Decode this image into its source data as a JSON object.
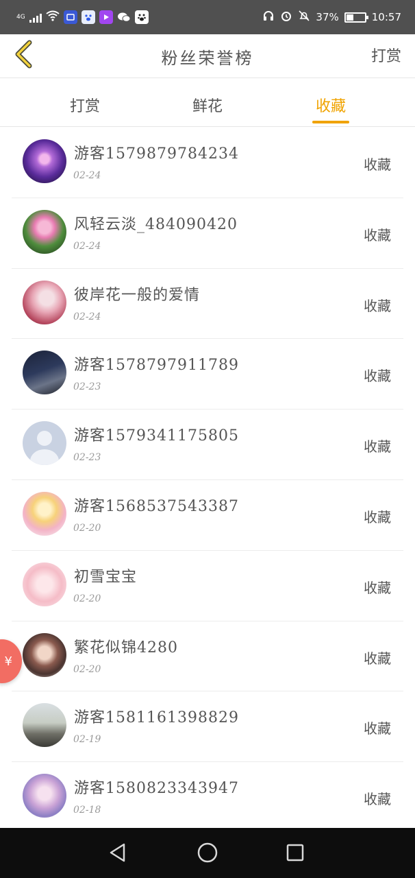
{
  "status_bar": {
    "network": "4G",
    "battery": "37%",
    "time": "10:57",
    "app_icons": [
      "app-badge-icon",
      "baidu-icon",
      "video-icon",
      "wechat-icon",
      "paw-icon"
    ]
  },
  "nav": {
    "title": "粉丝荣誉榜",
    "action": "打赏",
    "back_icon": "chevron-left-icon"
  },
  "tabs": [
    {
      "label": "打赏",
      "active": false
    },
    {
      "label": "鲜花",
      "active": false
    },
    {
      "label": "收藏",
      "active": true
    }
  ],
  "list": [
    {
      "name": "游客1579879784234",
      "date": "02-24",
      "action": "收藏"
    },
    {
      "name": "风轻云淡_484090420",
      "date": "02-24",
      "action": "收藏"
    },
    {
      "name": "彼岸花一般的爱情",
      "date": "02-24",
      "action": "收藏"
    },
    {
      "name": "游客1578797911789",
      "date": "02-23",
      "action": "收藏"
    },
    {
      "name": "游客1579341175805",
      "date": "02-23",
      "action": "收藏"
    },
    {
      "name": "游客1568537543387",
      "date": "02-20",
      "action": "收藏"
    },
    {
      "name": "初雪宝宝",
      "date": "02-20",
      "action": "收藏"
    },
    {
      "name": "繁花似锦4280",
      "date": "02-20",
      "action": "收藏"
    },
    {
      "name": "游客1581161398829",
      "date": "02-19",
      "action": "收藏"
    },
    {
      "name": "游客1580823343947",
      "date": "02-18",
      "action": "收藏"
    }
  ],
  "float_button": {
    "symbol": "¥"
  },
  "colors": {
    "accent": "#f0a300",
    "status_bar": "#505050",
    "system_nav": "#0d0d0d",
    "float_button": "#f26d63"
  }
}
